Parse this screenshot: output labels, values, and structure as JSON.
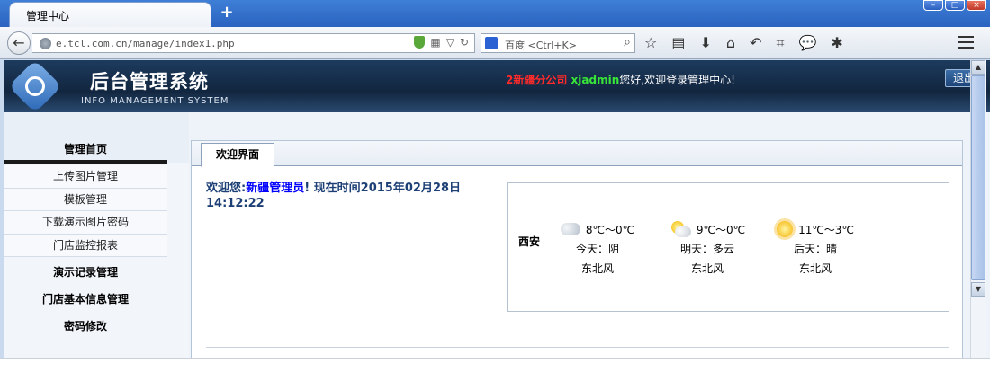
{
  "browser": {
    "tab_title": "管理中心",
    "new_tab": "+",
    "url": "e.tcl.com.cn/manage/index1.php",
    "search_placeholder": "百度 <Ctrl+K>"
  },
  "header": {
    "title": "后台管理系统",
    "subtitle": "INFO MANAGEMENT SYSTEM",
    "company": "2新疆分公司",
    "user": "xjadmin",
    "greeting": "您好,欢迎登录管理中心!",
    "logout": "退出"
  },
  "sidebar": {
    "home": "管理首页",
    "items": [
      {
        "label": "上传图片管理"
      },
      {
        "label": "模板管理"
      },
      {
        "label": "下载演示图片密码"
      },
      {
        "label": "门店监控报表"
      }
    ],
    "demo_records": "演示记录管理",
    "store_info": "门店基本信息管理",
    "password": "密码修改"
  },
  "main": {
    "tab": "欢迎界面",
    "welcome_prefix": "欢迎您:",
    "welcome_name": "新疆管理员",
    "welcome_suffix": "! 现在时间2015年02月28日 14:12:22"
  },
  "weather": {
    "city": "西安",
    "days": [
      {
        "temp": "8℃～0℃",
        "desc": "今天：阴",
        "wind": "东北风",
        "icon": "cloudy-icon"
      },
      {
        "temp": "9℃～0℃",
        "desc": "明天：多云",
        "wind": "东北风",
        "icon": "partly-cloudy-icon"
      },
      {
        "temp": "11℃～3℃",
        "desc": "后天：晴",
        "wind": "东北风",
        "icon": "sunny-icon"
      }
    ]
  },
  "colors": {
    "company": "#ff2a2a",
    "user": "#38e638",
    "welcome_name": "#0000ff",
    "header_bg": "#1d3b5e"
  }
}
